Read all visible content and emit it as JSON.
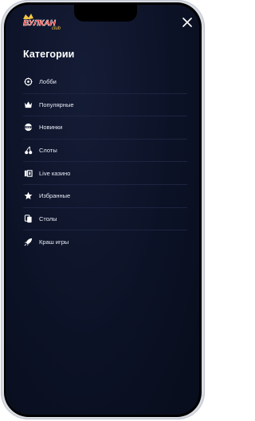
{
  "brand": {
    "logo_text": "ВУЛКАН",
    "logo_subtext": "club",
    "logo_color": "#e8211c",
    "logo_accent": "#f5c542"
  },
  "header": {
    "close_icon": "close-icon"
  },
  "menu": {
    "title": "Категории",
    "items": [
      {
        "label": "Лобби",
        "icon": "lobby-icon"
      },
      {
        "label": "Популярные",
        "icon": "crown-icon"
      },
      {
        "label": "Новинки",
        "icon": "new-badge-icon"
      },
      {
        "label": "Слоты",
        "icon": "cherries-icon"
      },
      {
        "label": "Live казино",
        "icon": "live-casino-icon"
      },
      {
        "label": "Избранные",
        "icon": "star-icon"
      },
      {
        "label": "Столы",
        "icon": "cards-icon"
      },
      {
        "label": "Краш игры",
        "icon": "rocket-icon"
      }
    ]
  },
  "colors": {
    "background": "#0c1226",
    "text": "#ffffff",
    "divider": "#1c2440"
  }
}
